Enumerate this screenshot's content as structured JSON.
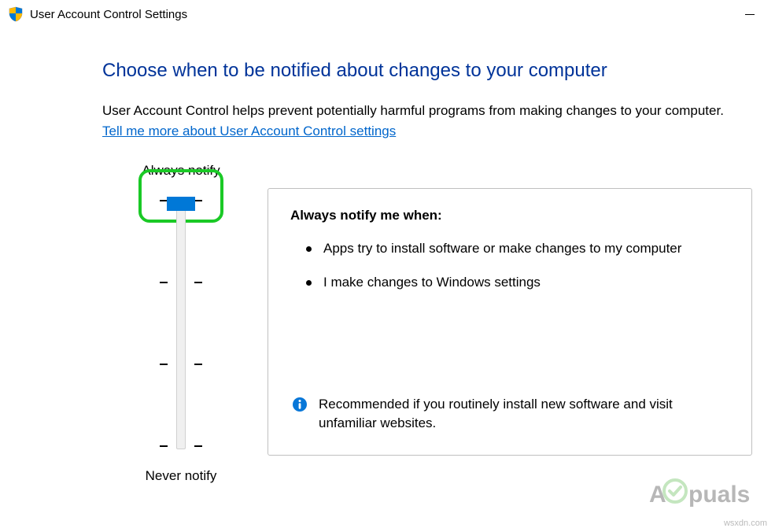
{
  "titlebar": {
    "title": "User Account Control Settings"
  },
  "heading": "Choose when to be notified about changes to your computer",
  "description": "User Account Control helps prevent potentially harmful programs from making changes to your computer.",
  "help_link": "Tell me more about User Account Control settings",
  "slider": {
    "top_label": "Always notify",
    "bottom_label": "Never notify",
    "position": 0,
    "levels": 4
  },
  "panel": {
    "heading": "Always notify me when:",
    "bullets": [
      "Apps try to install software or make changes to my computer",
      "I make changes to Windows settings"
    ],
    "recommend": "Recommended if you routinely install new software and visit unfamiliar websites."
  },
  "watermark": "wsxdn.com",
  "brand": "Appuals"
}
